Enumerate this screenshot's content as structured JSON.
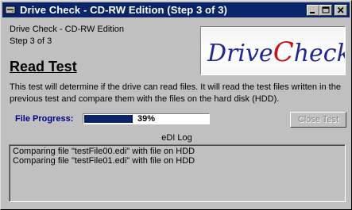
{
  "window": {
    "title": "Drive Check - CD-RW Edition (Step 3 of 3)",
    "controls": {
      "minimize": "minimize",
      "maximize": "maximize",
      "close": "close"
    }
  },
  "header": {
    "app_name": "Drive Check - CD-RW Edition",
    "step": "Step 3 of 3",
    "logo_text": "DriveCheck",
    "logo_part1": "Drive",
    "logo_part2": "C",
    "logo_part3": "heck",
    "logo_colors": {
      "blue": "#20269a",
      "red": "#cc1010"
    }
  },
  "main": {
    "heading": "Read Test",
    "description": "This test will determine if the drive can read files.  It will read the test files written in the previous test and compare them with the files on the hard disk (HDD).",
    "progress_label": "File Progress:",
    "progress_value": 0.39,
    "progress_text": "39%",
    "close_button": "Close Test",
    "close_button_enabled": false
  },
  "log": {
    "caption": "eDI Log",
    "lines": [
      "Comparing file \"testFile00.edi\" with file on HDD",
      "Comparing file \"testFile01.edi\" with file on HDD"
    ]
  },
  "colors": {
    "titlebar": "#0a246a",
    "progress": "#0a246a",
    "face": "#c0c0c0",
    "label": "#00008b"
  }
}
